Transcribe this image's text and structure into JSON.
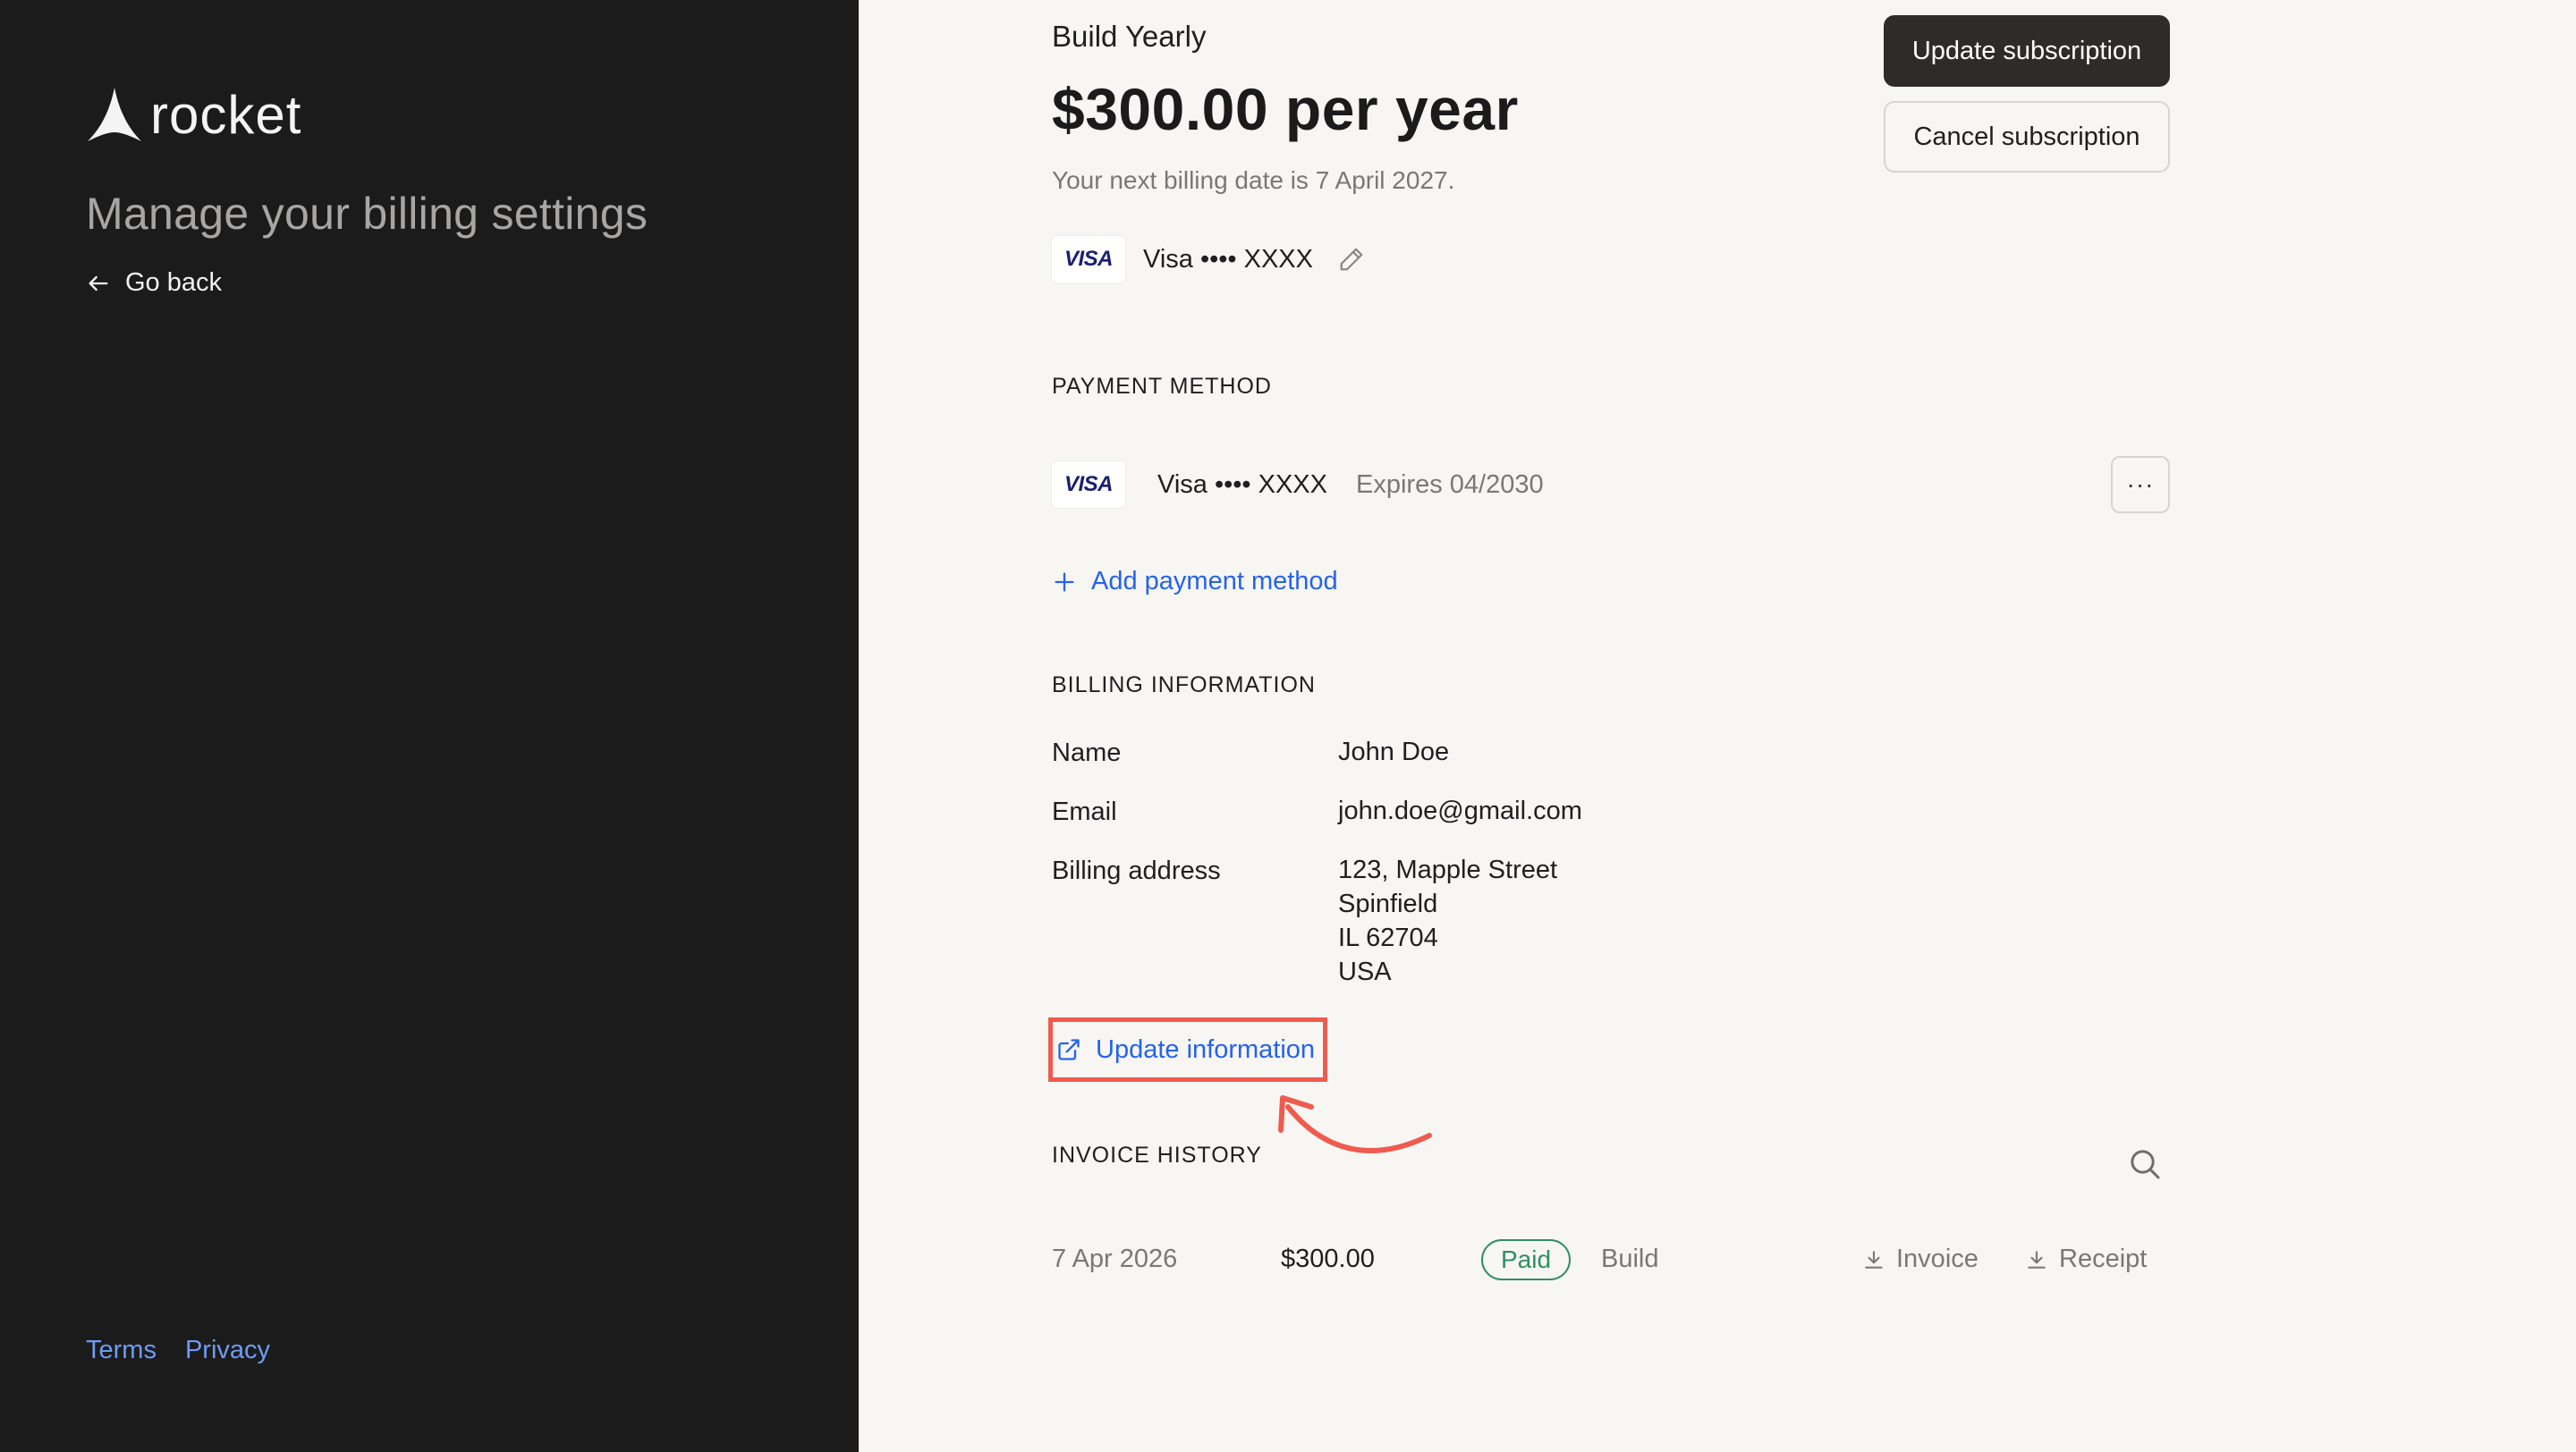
{
  "sidebar": {
    "logo_text": "rocket",
    "title": "Manage your billing settings",
    "go_back": "Go back",
    "footer": {
      "terms": "Terms",
      "privacy": "Privacy"
    }
  },
  "subscription": {
    "plan_name": "Build Yearly",
    "price": "$300.00 per year",
    "next_billing": "Your next billing date is 7 April 2027.",
    "card_brand": "VISA",
    "card_label": "Visa •••• XXXX",
    "update_button": "Update subscription",
    "cancel_button": "Cancel subscription"
  },
  "payment_method": {
    "section_title": "PAYMENT METHOD",
    "card_brand": "VISA",
    "card_label": "Visa •••• XXXX",
    "expiry": "Expires 04/2030",
    "more_label": "···",
    "add_label": "Add payment method"
  },
  "billing_info": {
    "section_title": "BILLING INFORMATION",
    "name_label": "Name",
    "name_value": "John Doe",
    "email_label": "Email",
    "email_value": "john.doe@gmail.com",
    "address_label": "Billing address",
    "address_lines": [
      "123, Mapple Street",
      "Spinfield",
      "IL 62704",
      "USA"
    ],
    "update_link": "Update information"
  },
  "invoice_history": {
    "section_title": "INVOICE HISTORY",
    "rows": [
      {
        "date": "7 Apr 2026",
        "amount": "$300.00",
        "status": "Paid",
        "plan": "Build",
        "invoice_label": "Invoice",
        "receipt_label": "Receipt"
      }
    ]
  },
  "colors": {
    "sidebar_bg": "#1c1b1b",
    "main_bg": "#f7f6f3",
    "link_blue": "#2563eb",
    "annotation_red": "#ef5b4f",
    "paid_green": "#2f8f62"
  }
}
